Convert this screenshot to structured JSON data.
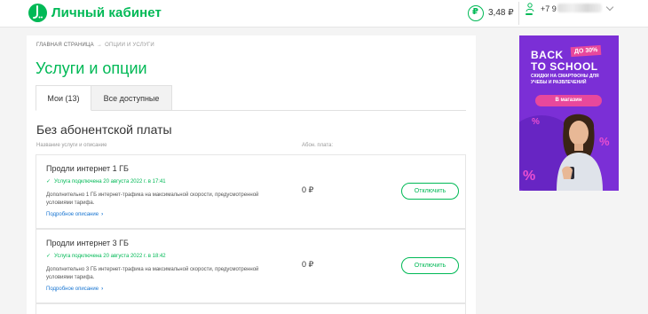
{
  "header": {
    "logo_text": "Личный кабинет",
    "balance_currency_symbol": "₽",
    "balance": "3,48 ₽",
    "phone_prefix": "+7 9",
    "brand_color": "#00b956"
  },
  "breadcrumb": {
    "home": "ГЛАВНАЯ СТРАНИЦА",
    "arrow": "→",
    "current": "ОПЦИИ И УСЛУГИ"
  },
  "page": {
    "title": "Услуги и опции",
    "tabs": [
      {
        "label": "Мои (13)",
        "active": true
      },
      {
        "label": "Все доступные",
        "active": false
      }
    ],
    "section_title": "Без абонентской платы",
    "columns": {
      "name": "Название услуги и описание",
      "fee": "Абон. плата:"
    }
  },
  "services": [
    {
      "name": "Продли интернет 1 ГБ",
      "status_icon": "check-icon",
      "status": "Услуга подключена 20 августа 2022 г. в 17:41",
      "description": "Дополнительно 1 ГБ интернет-трафика на максимальной скорости, предусмотренной условиями тарифа.",
      "more": "Подробное описание",
      "fee": "0 ₽",
      "button": "Отключить"
    },
    {
      "name": "Продли интернет 3 ГБ",
      "status_icon": "check-icon",
      "status": "Услуга подключена 20 августа 2022 г. в 18:42",
      "description": "Дополнительно 3 ГБ интернет-трафика на максимальной скорости, предусмотренной условиями тарифа.",
      "more": "Подробное описание",
      "fee": "0 ₽",
      "button": "Отключить"
    }
  ],
  "ad": {
    "title_line1": "BACK",
    "title_line2": "TO SCHOOL",
    "badge": "ДО 30%",
    "subtitle": "СКИДКИ НА СМАРТФОНЫ ДЛЯ УЧЕБЫ И РАЗВЛЕЧЕНИЙ",
    "button": "В магазин",
    "background_color": "#7b2fd6",
    "accent_color": "#e8489c"
  }
}
